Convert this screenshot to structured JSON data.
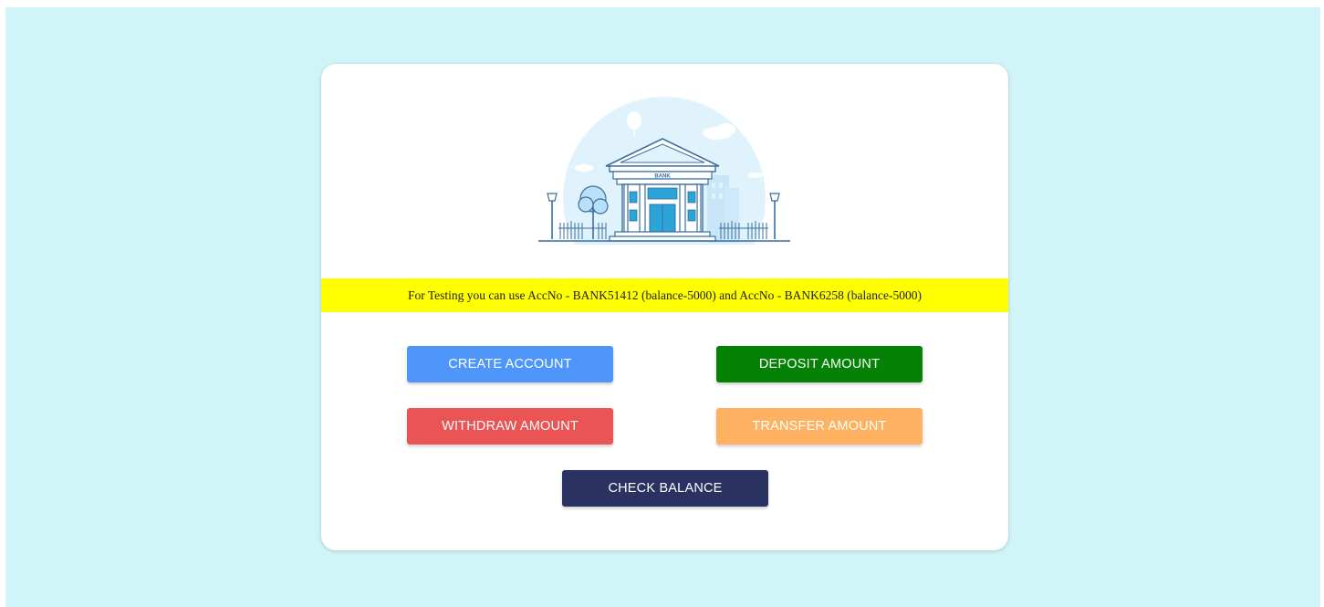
{
  "notice": {
    "text": "For Testing you can use AccNo - BANK51412 (balance-5000) and AccNo - BANK6258 (balance-5000)"
  },
  "illustration": {
    "sign_text": "BANK",
    "icon": "bank-building-illustration"
  },
  "buttons": {
    "create_account": "CREATE ACCOUNT",
    "deposit_amount": "DEPOSIT AMOUNT",
    "withdraw_amount": "WITHDRAW AMOUNT",
    "transfer_amount": "TRANSFER AMOUNT",
    "check_balance": "CHECK BALANCE"
  },
  "colors": {
    "page_background": "#d0f4f7",
    "notice_background": "#ffff00",
    "create_account": "#4f96fb",
    "deposit_amount": "#058205",
    "withdraw_amount": "#ea5454",
    "transfer_amount": "#feb261",
    "check_balance": "#2a3262"
  }
}
